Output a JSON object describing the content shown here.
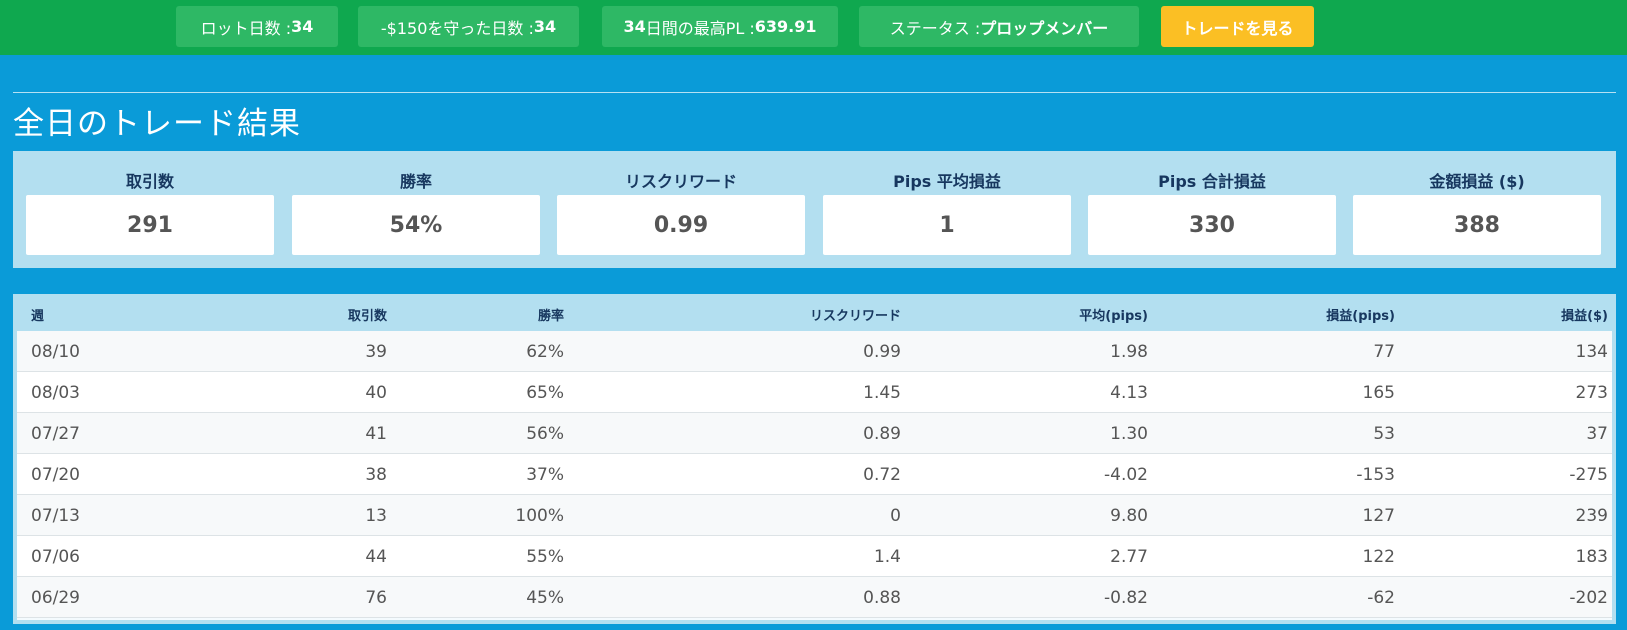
{
  "topbar": {
    "lot_days_label": "ロット日数 : ",
    "lot_days_value": "34",
    "protected_days_label": "-$150を守った日数 : ",
    "protected_days_value": "34",
    "best_pl_prefix": "34",
    "best_pl_label": "日間の最高PL : ",
    "best_pl_value": "639.91",
    "status_label": "ステータス : ",
    "status_value": "プロップメンバー",
    "view_trades_button": "トレードを見る"
  },
  "section_title": "全日のトレード結果",
  "stats": [
    {
      "label": "取引数",
      "value": "291"
    },
    {
      "label": "勝率",
      "value": "54%"
    },
    {
      "label": "リスクリワード",
      "value": "0.99"
    },
    {
      "label": "Pips 平均損益",
      "value": "1"
    },
    {
      "label": "Pips 合計損益",
      "value": "330"
    },
    {
      "label": "金額損益 ($)",
      "value": "388"
    }
  ],
  "table": {
    "headers": [
      "週",
      "取引数",
      "勝率",
      "リスクリワード",
      "平均(pips)",
      "損益(pips)",
      "損益($)"
    ],
    "rows": [
      [
        "08/10",
        "39",
        "62%",
        "0.99",
        "1.98",
        "77",
        "134"
      ],
      [
        "08/03",
        "40",
        "65%",
        "1.45",
        "4.13",
        "165",
        "273"
      ],
      [
        "07/27",
        "41",
        "56%",
        "0.89",
        "1.30",
        "53",
        "37"
      ],
      [
        "07/20",
        "38",
        "37%",
        "0.72",
        "-4.02",
        "-153",
        "-275"
      ],
      [
        "07/13",
        "13",
        "100%",
        "0",
        "9.80",
        "127",
        "239"
      ],
      [
        "07/06",
        "44",
        "55%",
        "1.4",
        "2.77",
        "122",
        "183"
      ],
      [
        "06/29",
        "76",
        "45%",
        "0.88",
        "-0.82",
        "-62",
        "-202"
      ]
    ]
  },
  "colors": {
    "topbar": "#0fa84f",
    "pill": "#2eb865",
    "cta": "#fbbf24",
    "background": "#0a9bd8",
    "panel": "#b3dff0",
    "heading_text": "#17375f"
  }
}
